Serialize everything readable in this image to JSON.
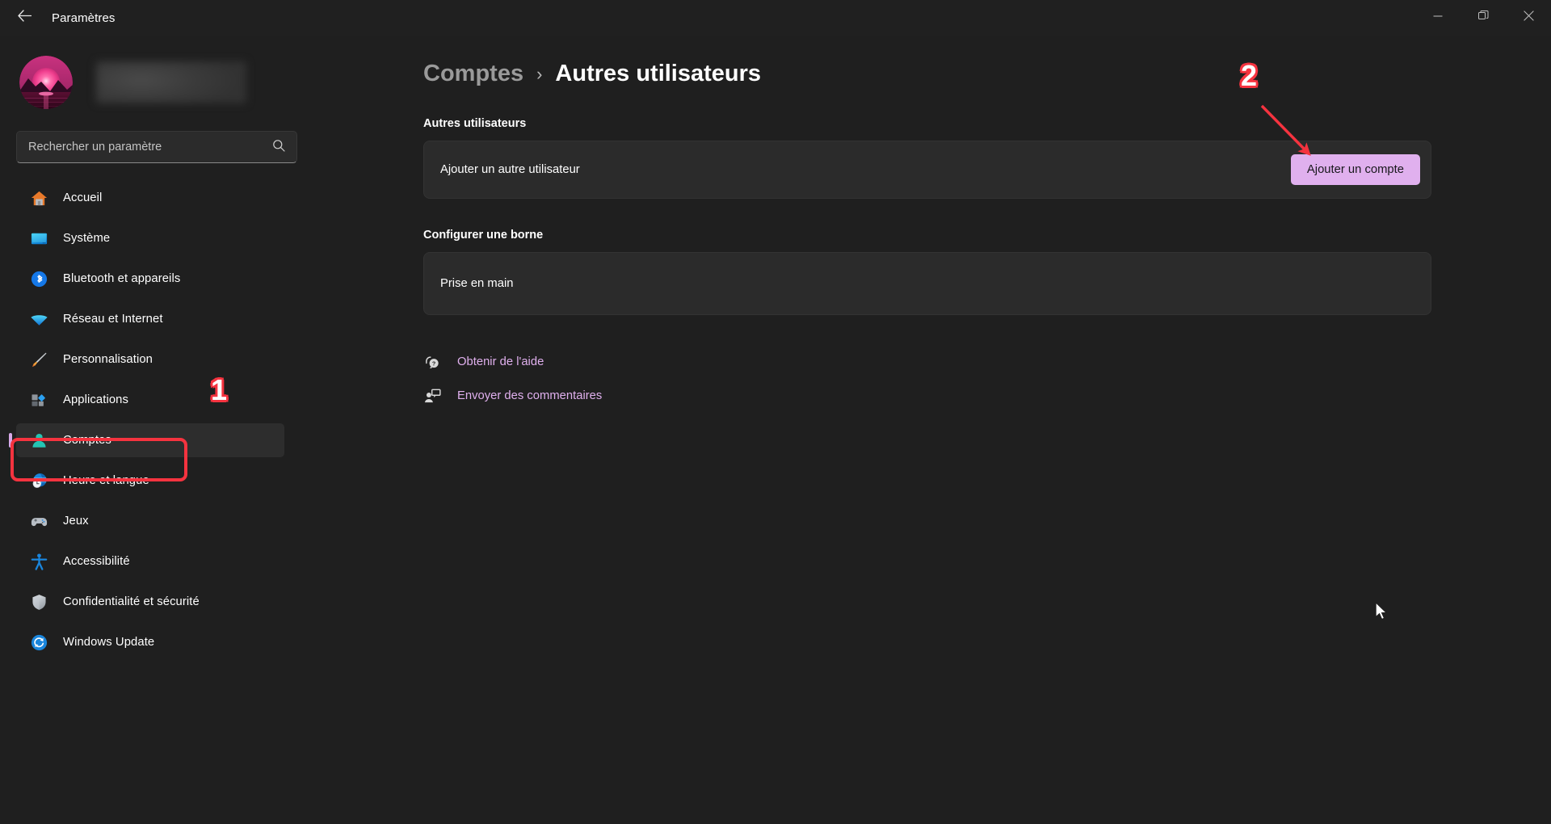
{
  "window": {
    "title": "Paramètres",
    "back_icon": "arrow-left-icon",
    "controls": {
      "minimize": "minimize-icon",
      "restore": "restore-icon",
      "close": "close-icon"
    }
  },
  "sidebar": {
    "profile": {
      "avatar_icon": "user-avatar-sunset",
      "name": ""
    },
    "search": {
      "placeholder": "Rechercher un paramètre",
      "value": "",
      "icon": "search-icon"
    },
    "items": [
      {
        "label": "Accueil",
        "icon": "home-icon",
        "selected": false
      },
      {
        "label": "Système",
        "icon": "display-icon",
        "selected": false
      },
      {
        "label": "Bluetooth et appareils",
        "icon": "bluetooth-icon",
        "selected": false
      },
      {
        "label": "Réseau et Internet",
        "icon": "wifi-icon",
        "selected": false
      },
      {
        "label": "Personnalisation",
        "icon": "paintbrush-icon",
        "selected": false
      },
      {
        "label": "Applications",
        "icon": "apps-icon",
        "selected": false
      },
      {
        "label": "Comptes",
        "icon": "accounts-icon",
        "selected": true
      },
      {
        "label": "Heure et langue",
        "icon": "clock-globe-icon",
        "selected": false
      },
      {
        "label": "Jeux",
        "icon": "gamepad-icon",
        "selected": false
      },
      {
        "label": "Accessibilité",
        "icon": "accessibility-icon",
        "selected": false
      },
      {
        "label": "Confidentialité et sécurité",
        "icon": "shield-icon",
        "selected": false
      },
      {
        "label": "Windows Update",
        "icon": "update-icon",
        "selected": false
      }
    ]
  },
  "main": {
    "breadcrumb": {
      "parent": "Comptes",
      "separator": "›",
      "current": "Autres utilisateurs"
    },
    "sections": [
      {
        "heading": "Autres utilisateurs",
        "row_label": "Ajouter un autre utilisateur",
        "button_label": "Ajouter un compte"
      },
      {
        "heading": "Configurer une borne",
        "row_label": "Prise en main"
      }
    ],
    "links": [
      {
        "label": "Obtenir de l'aide",
        "icon": "help-icon"
      },
      {
        "label": "Envoyer des commentaires",
        "icon": "feedback-icon"
      }
    ]
  },
  "annotations": {
    "colors": {
      "marker": "#f5333f",
      "accent": "#e0b0ee",
      "selected_bar": "#d8a9e8"
    },
    "markers": [
      {
        "number": "1",
        "target": "sidebar-item-comptes"
      },
      {
        "number": "2",
        "target": "add-account-button"
      }
    ]
  }
}
